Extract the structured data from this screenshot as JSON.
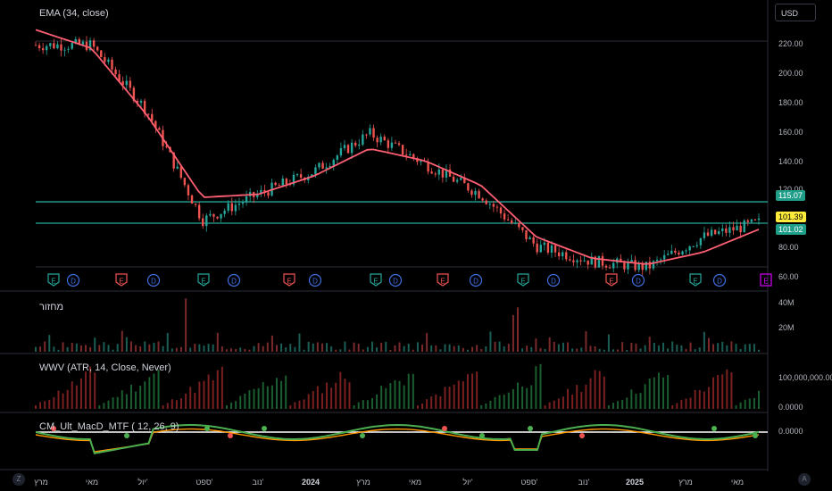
{
  "header": {
    "currency": "USD"
  },
  "main_pane": {
    "title": "EMA (34, close)",
    "y_labels": [
      "220.00",
      "200.00",
      "180.00",
      "160.00",
      "140.00",
      "120.00",
      "80.00",
      "60.00"
    ],
    "tags": {
      "resistance": "115.07",
      "last": "101.39",
      "support": "101.02"
    }
  },
  "volume_pane": {
    "title": "מחזור",
    "y_labels": [
      "40M",
      "20M"
    ]
  },
  "wwv_pane": {
    "title": "WWV (ATR, 14, Close, Never)",
    "y_labels": [
      "100,000,000.00",
      "0.0000"
    ]
  },
  "macd_pane": {
    "title": "CM_Ult_MacD_MTF ( 12, 26, 9)",
    "y_labels": [
      "0.0000"
    ]
  },
  "x_axis": [
    "מרץ",
    "מאי",
    "יול'",
    "ספט'",
    "נוב'",
    "2024",
    "מרץ",
    "מאי",
    "יול'",
    "ספט'",
    "נוב'",
    "2025",
    "מרץ",
    "מאי"
  ],
  "footer": {
    "left_icon": "Z",
    "right_icon": "A"
  },
  "events": [
    "E",
    "D",
    "E",
    "D",
    "E",
    "D",
    "E",
    "D",
    "E",
    "D",
    "E",
    "D",
    "E",
    "D",
    "E",
    "D",
    "E",
    "D",
    "E"
  ],
  "colors": {
    "ema": "#ff5f73",
    "teal_line": "#26a69a",
    "up": "#26a69a",
    "down": "#ef5350",
    "macd_fast": "#4caf50",
    "macd_slow": "#ff9800"
  },
  "chart_data": {
    "type": "line",
    "title": "EMA (34, close)",
    "x": [
      "2023-03",
      "2023-05",
      "2023-07",
      "2023-09",
      "2023-11",
      "2024-01",
      "2024-03",
      "2024-05",
      "2024-07",
      "2024-09",
      "2024-11",
      "2025-01",
      "2025-03",
      "2025-05"
    ],
    "series": [
      {
        "name": "EMA (34, close)",
        "values": [
          228,
          216,
          172,
          118,
          120,
          132,
          150,
          142,
          126,
          92,
          78,
          74,
          82,
          97
        ]
      },
      {
        "name": "Close",
        "values": [
          218,
          218,
          175,
          103,
          120,
          135,
          160,
          140,
          120,
          86,
          76,
          72,
          92,
          101.39
        ]
      }
    ],
    "hlines": [
      115.07,
      101.02
    ],
    "ylim": [
      60,
      230
    ]
  }
}
